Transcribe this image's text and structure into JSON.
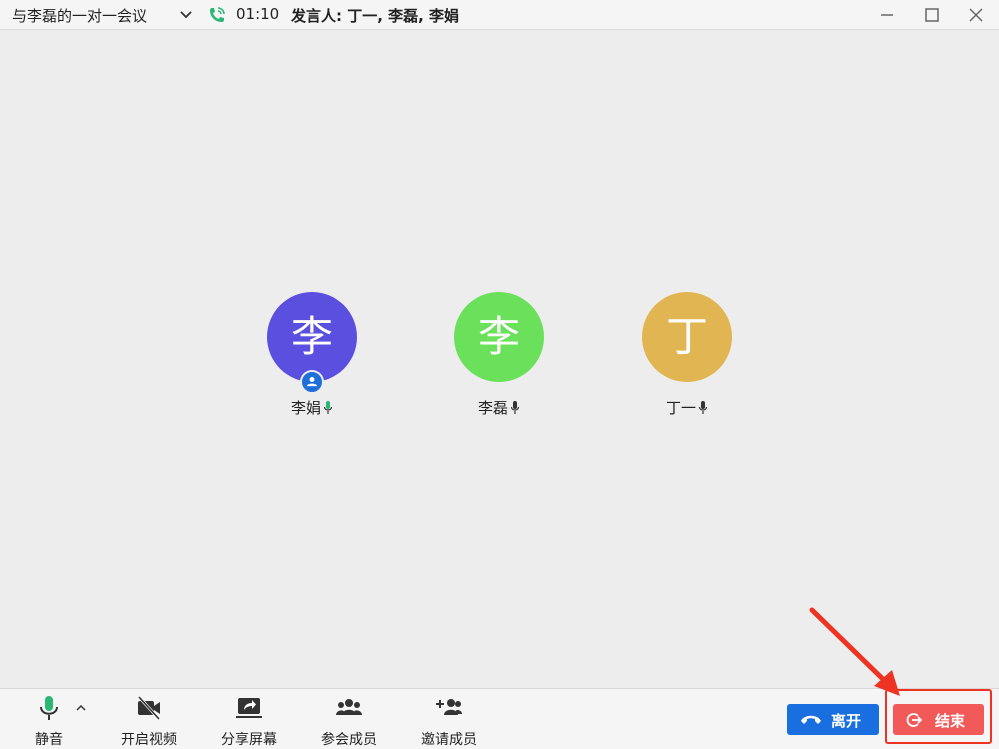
{
  "titlebar": {
    "meeting_title": "与李磊的一对一会议",
    "duration": "01:10",
    "speakers": "发言人: 丁一, 李磊, 李娟",
    "call_icon_color": "#2bb673"
  },
  "participants": [
    {
      "initial": "李",
      "name": "李娟",
      "color": "#5b4fe0",
      "is_host": true
    },
    {
      "initial": "李",
      "name": "李磊",
      "color": "#6be05a",
      "is_host": false
    },
    {
      "initial": "丁",
      "name": "丁一",
      "color": "#e0b552",
      "is_host": false
    }
  ],
  "toolbar": {
    "mute_label": "静音",
    "video_label": "开启视频",
    "share_label": "分享屏幕",
    "members_label": "参会成员",
    "invite_label": "邀请成员",
    "leave_label": "离开",
    "end_label": "结束"
  },
  "colors": {
    "leave_button": "#1a6fe0",
    "end_button": "#f25a5a",
    "highlight": "#ee3322",
    "mic_active": "#2bb673"
  }
}
